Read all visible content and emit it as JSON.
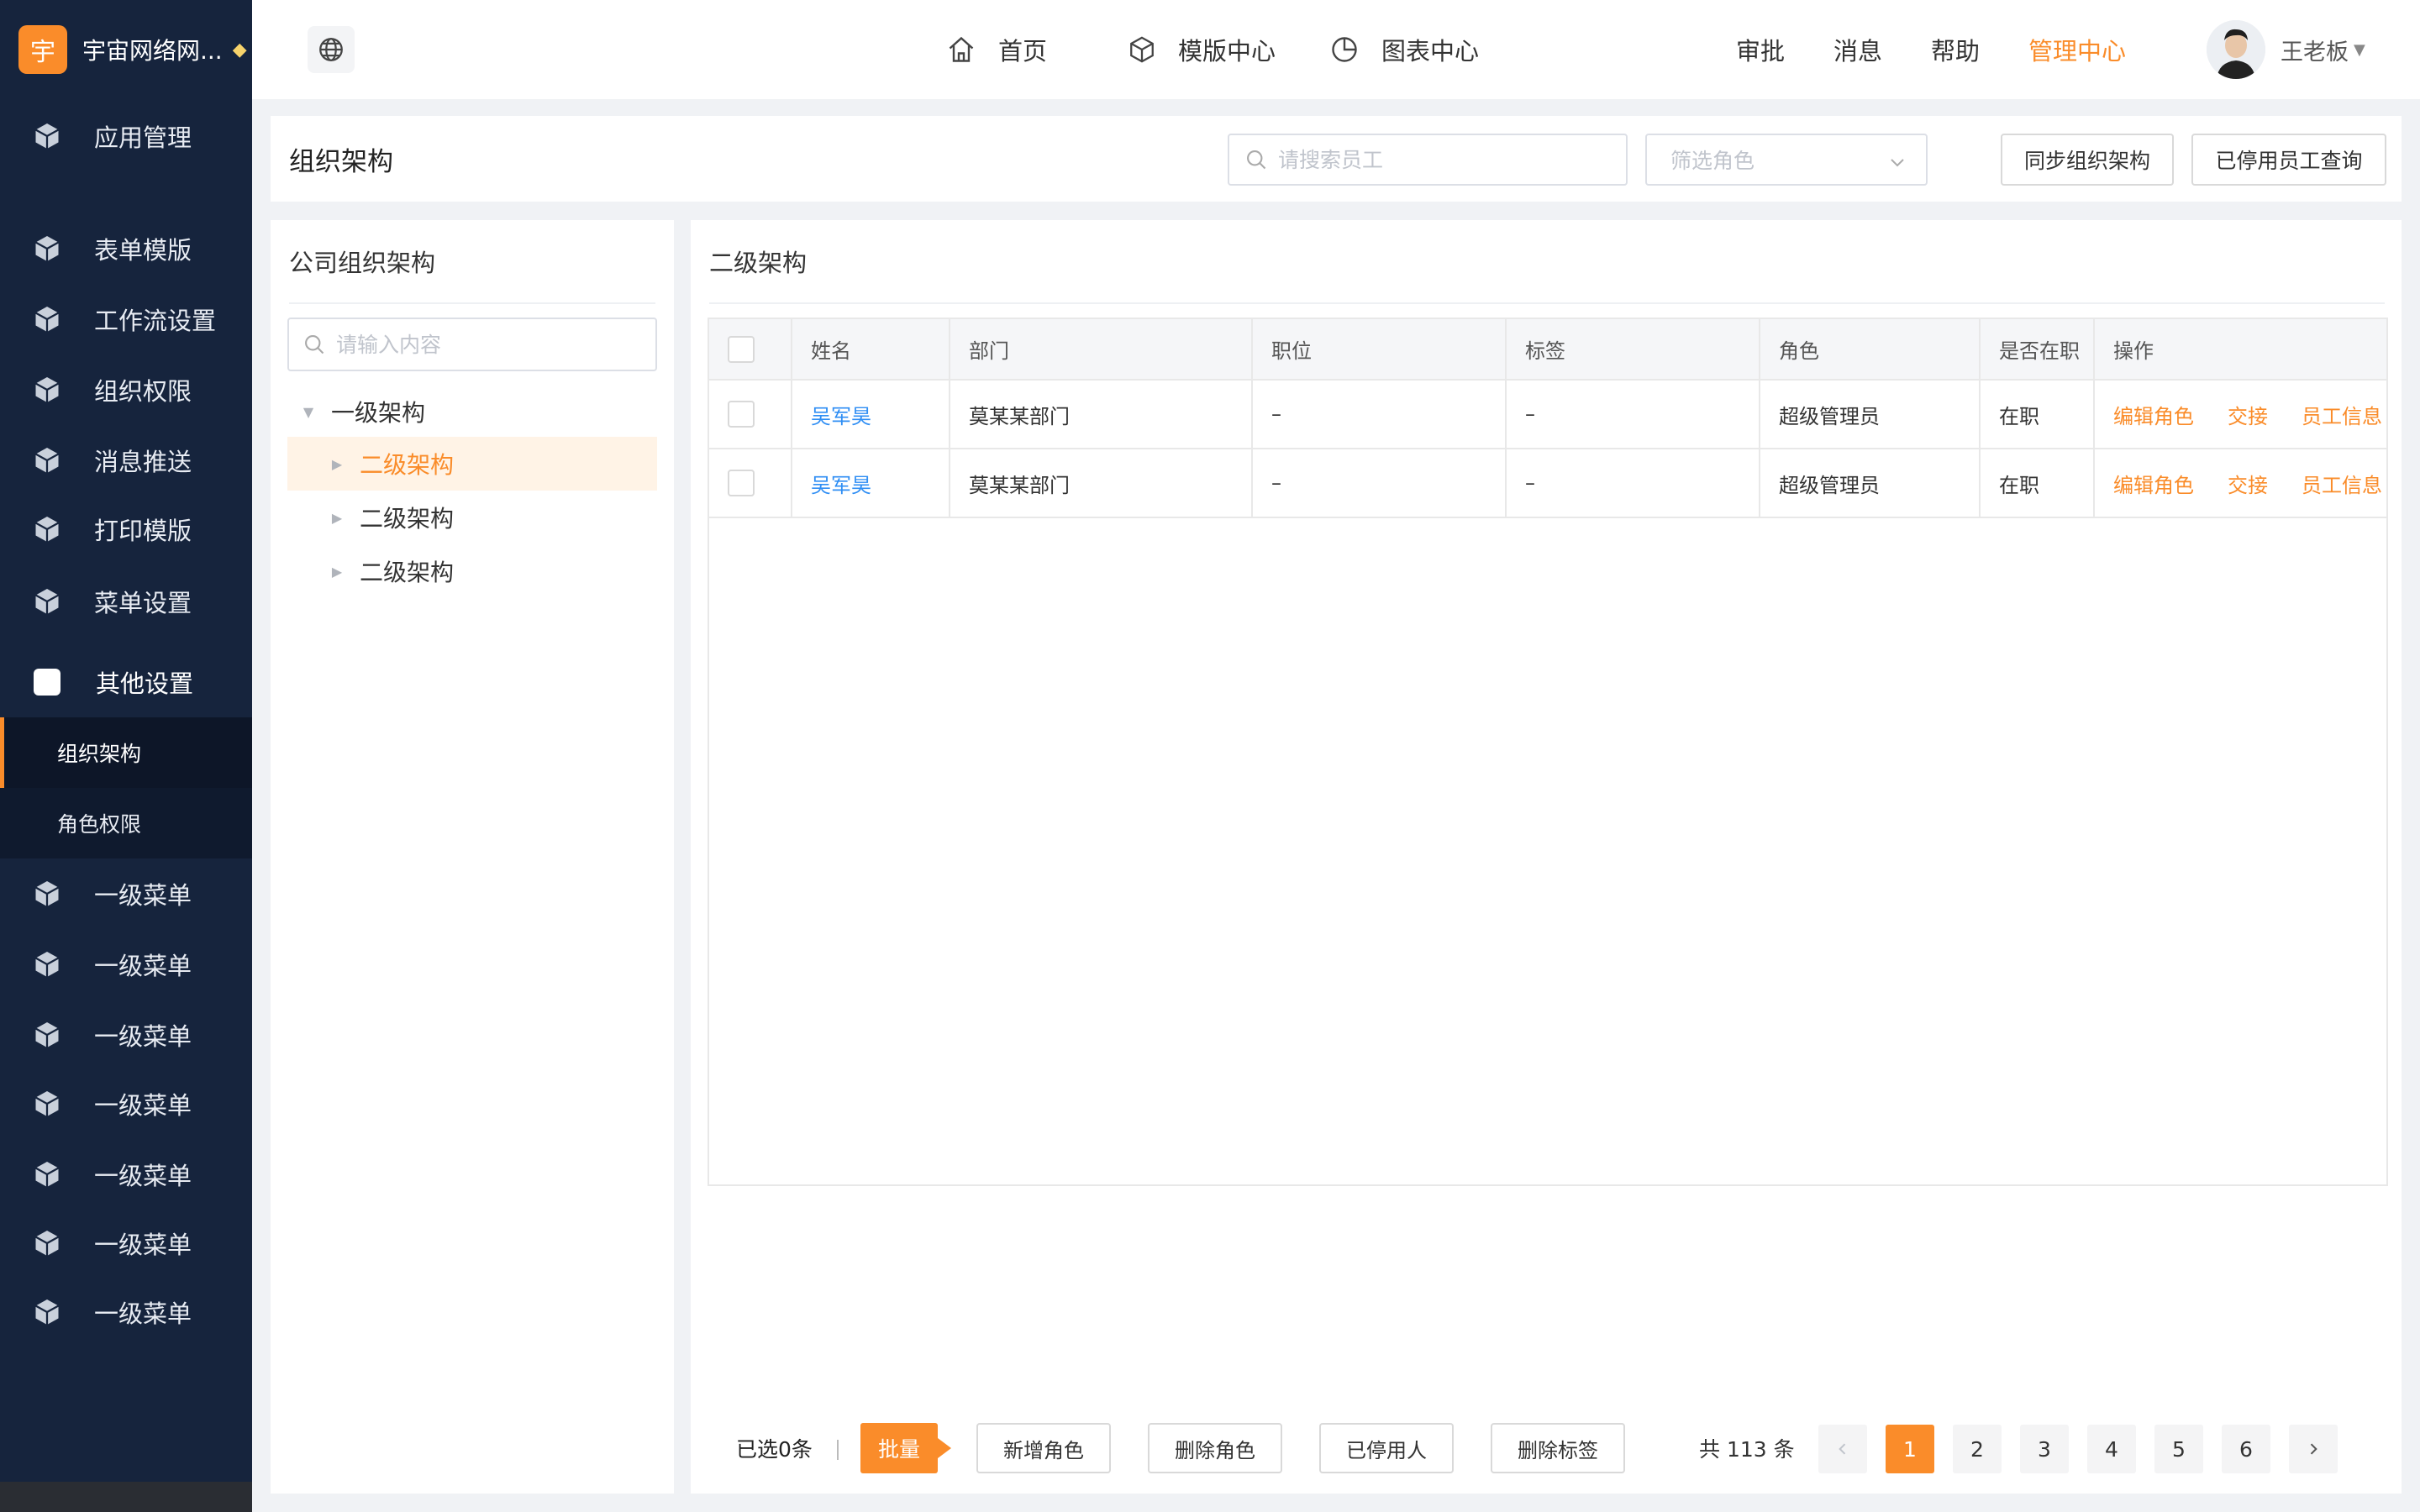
{
  "brand": {
    "logo_char": "宇",
    "name": "宇宙网络网..."
  },
  "sidebar": {
    "items": [
      {
        "label": "应用管理"
      },
      {
        "label": "表单模版"
      },
      {
        "label": "工作流设置"
      },
      {
        "label": "组织权限"
      },
      {
        "label": "消息推送"
      },
      {
        "label": "打印模版"
      },
      {
        "label": "菜单设置"
      },
      {
        "label": "其他设置"
      }
    ],
    "sub_items": [
      {
        "label": "组织架构"
      },
      {
        "label": "角色权限"
      }
    ],
    "bottom_items": [
      {
        "label": "一级菜单"
      },
      {
        "label": "一级菜单"
      },
      {
        "label": "一级菜单"
      },
      {
        "label": "一级菜单"
      },
      {
        "label": "一级菜单"
      },
      {
        "label": "一级菜单"
      },
      {
        "label": "一级菜单"
      }
    ]
  },
  "topbar": {
    "nav": [
      {
        "label": "首页"
      },
      {
        "label": "模版中心"
      },
      {
        "label": "图表中心"
      }
    ],
    "right": [
      {
        "label": "审批"
      },
      {
        "label": "消息"
      },
      {
        "label": "帮助"
      },
      {
        "label": "管理中心"
      }
    ],
    "user_name": "王老板"
  },
  "header": {
    "title": "组织架构",
    "search_placeholder": "请搜索员工",
    "role_select_placeholder": "筛选角色",
    "sync_button": "同步组织架构",
    "disabled_query_button": "已停用员工查询"
  },
  "tree": {
    "title": "公司组织架构",
    "search_placeholder": "请输入内容",
    "root": "一级架构",
    "children": [
      {
        "label": "二级架构"
      },
      {
        "label": "二级架构"
      },
      {
        "label": "二级架构"
      }
    ]
  },
  "main": {
    "title": "二级架构",
    "columns": [
      "姓名",
      "部门",
      "职位",
      "标签",
      "角色",
      "是否在职",
      "操作"
    ],
    "rows": [
      {
        "name": "吴军昊",
        "dept": "莫某某部门",
        "position": "–",
        "tag": "–",
        "role": "超级管理员",
        "status": "在职"
      },
      {
        "name": "吴军昊",
        "dept": "莫某某部门",
        "position": "–",
        "tag": "–",
        "role": "超级管理员",
        "status": "在职"
      }
    ],
    "actions": [
      "编辑角色",
      "交接",
      "员工信息"
    ]
  },
  "footer": {
    "selected": "已选0条",
    "batch": "批量",
    "buttons": [
      "新增角色",
      "删除角色",
      "已停用人",
      "删除标签"
    ],
    "total": "共 113 条",
    "pages": [
      "1",
      "2",
      "3",
      "4",
      "5",
      "6"
    ],
    "current_page": "1"
  },
  "colors": {
    "accent": "#fa8c2a",
    "sidebar_bg": "#16243d",
    "link": "#2f8ef4"
  }
}
